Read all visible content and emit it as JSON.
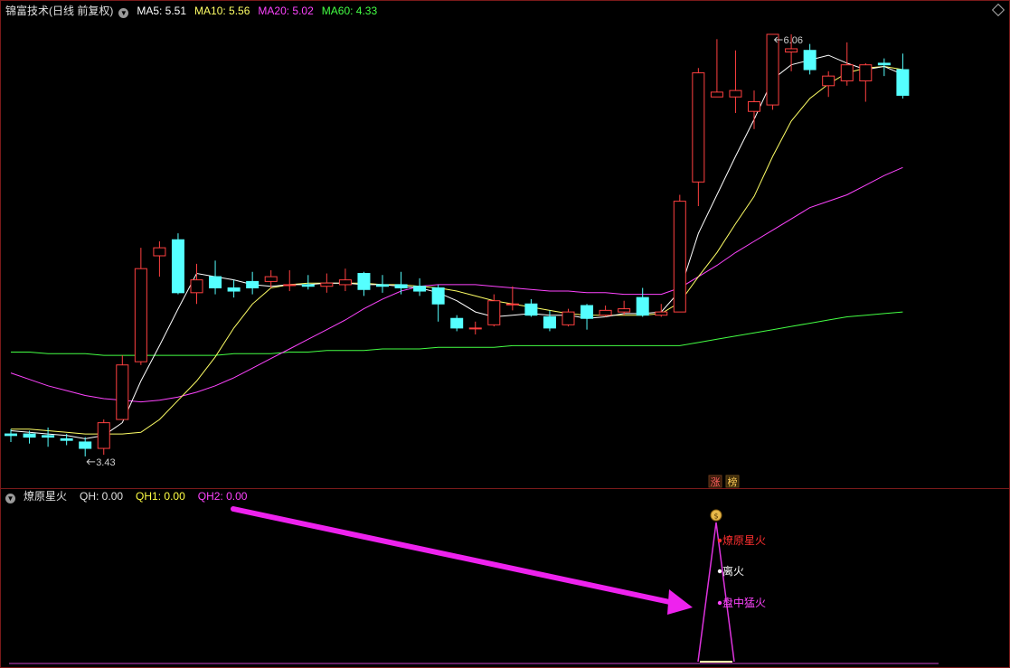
{
  "main_panel": {
    "title": "锦富技术(日线 前复权)",
    "indicators": [
      {
        "label": "MA5: 5.51",
        "color": "#ffffff"
      },
      {
        "label": "MA10: 5.56",
        "color": "#ffff66"
      },
      {
        "label": "MA20: 5.02",
        "color": "#ff44ff"
      },
      {
        "label": "MA60: 4.33",
        "color": "#44ff44"
      }
    ],
    "high_label": "6.06",
    "low_label": "3.43",
    "badges": [
      "涨",
      "榜"
    ]
  },
  "sub_panel": {
    "title": "燎原星火",
    "indicators": [
      {
        "label": "QH: 0.00",
        "color": "#e0e0e0"
      },
      {
        "label": "QH1: 0.00",
        "color": "#ffff44"
      },
      {
        "label": "QH2: 0.00",
        "color": "#ff44ff"
      }
    ],
    "signal_labels": [
      {
        "text": "燎原星火",
        "color": "#ff3030"
      },
      {
        "text": "离火",
        "color": "#ffffff"
      },
      {
        "text": "盘中猛火",
        "color": "#ff44ff"
      }
    ],
    "signal_icon": "money-bag-icon"
  },
  "colors": {
    "up": "#ff4040",
    "down": "#55ffff",
    "ma5": "#ffffff",
    "ma10": "#ffff66",
    "ma20": "#ff44ff",
    "ma60": "#44ff44"
  },
  "chart_data": {
    "type": "candlestick",
    "price_ylim": [
      3.3,
      6.15
    ],
    "candles": [
      [
        3.57,
        3.56,
        3.6,
        3.52
      ],
      [
        3.57,
        3.55,
        3.59,
        3.51
      ],
      [
        3.56,
        3.55,
        3.61,
        3.49
      ],
      [
        3.54,
        3.53,
        3.57,
        3.5
      ],
      [
        3.52,
        3.48,
        3.55,
        3.43
      ],
      [
        3.48,
        3.64,
        3.66,
        3.44
      ],
      [
        3.66,
        4.0,
        4.06,
        3.66
      ],
      [
        4.02,
        4.6,
        4.73,
        4.0
      ],
      [
        4.68,
        4.73,
        4.77,
        4.55
      ],
      [
        4.78,
        4.45,
        4.82,
        4.44
      ],
      [
        4.45,
        4.53,
        4.63,
        4.38
      ],
      [
        4.55,
        4.48,
        4.65,
        4.44
      ],
      [
        4.48,
        4.46,
        4.53,
        4.42
      ],
      [
        4.52,
        4.48,
        4.58,
        4.44
      ],
      [
        4.52,
        4.55,
        4.59,
        4.48
      ],
      [
        4.5,
        4.5,
        4.59,
        4.46
      ],
      [
        4.5,
        4.49,
        4.56,
        4.47
      ],
      [
        4.49,
        4.51,
        4.57,
        4.45
      ],
      [
        4.5,
        4.53,
        4.6,
        4.46
      ],
      [
        4.57,
        4.47,
        4.58,
        4.43
      ],
      [
        4.5,
        4.49,
        4.56,
        4.45
      ],
      [
        4.5,
        4.48,
        4.58,
        4.44
      ],
      [
        4.49,
        4.46,
        4.54,
        4.43
      ],
      [
        4.48,
        4.38,
        4.5,
        4.27
      ],
      [
        4.29,
        4.23,
        4.31,
        4.21
      ],
      [
        4.23,
        4.23,
        4.27,
        4.19
      ],
      [
        4.25,
        4.4,
        4.44,
        4.24
      ],
      [
        4.38,
        4.38,
        4.49,
        4.34
      ],
      [
        4.38,
        4.31,
        4.41,
        4.3
      ],
      [
        4.3,
        4.23,
        4.34,
        4.21
      ],
      [
        4.25,
        4.33,
        4.35,
        4.24
      ],
      [
        4.37,
        4.29,
        4.38,
        4.22
      ],
      [
        4.31,
        4.34,
        4.37,
        4.3
      ],
      [
        4.33,
        4.35,
        4.4,
        4.31
      ],
      [
        4.42,
        4.31,
        4.48,
        4.3
      ],
      [
        4.31,
        4.33,
        4.38,
        4.3
      ],
      [
        4.33,
        5.02,
        5.06,
        4.33
      ],
      [
        5.14,
        5.82,
        5.85,
        4.99
      ],
      [
        5.67,
        5.7,
        6.03,
        5.67
      ],
      [
        5.67,
        5.71,
        5.96,
        5.57
      ],
      [
        5.58,
        5.64,
        5.71,
        5.47
      ],
      [
        5.62,
        6.06,
        6.06,
        5.59
      ],
      [
        5.95,
        5.97,
        6.06,
        5.83
      ],
      [
        5.96,
        5.84,
        6.0,
        5.81
      ],
      [
        5.74,
        5.8,
        5.83,
        5.67
      ],
      [
        5.77,
        5.87,
        6.01,
        5.74
      ],
      [
        5.77,
        5.87,
        5.88,
        5.64
      ],
      [
        5.88,
        5.87,
        5.91,
        5.8
      ],
      [
        5.84,
        5.68,
        5.94,
        5.66
      ]
    ],
    "ma5": [
      3.59,
      3.58,
      3.57,
      3.56,
      3.54,
      3.56,
      3.64,
      3.9,
      4.12,
      4.35,
      4.57,
      4.55,
      4.53,
      4.5,
      4.49,
      4.5,
      4.5,
      4.51,
      4.51,
      4.5,
      4.5,
      4.49,
      4.48,
      4.45,
      4.4,
      4.33,
      4.3,
      4.31,
      4.32,
      4.31,
      4.31,
      4.29,
      4.3,
      4.32,
      4.32,
      4.33,
      4.46,
      4.82,
      5.06,
      5.3,
      5.53,
      5.78,
      5.87,
      5.9,
      5.93,
      5.88,
      5.84,
      5.86,
      5.81
    ],
    "ma10": [
      3.6,
      3.6,
      3.59,
      3.58,
      3.57,
      3.57,
      3.57,
      3.58,
      3.66,
      3.78,
      3.9,
      4.05,
      4.23,
      4.38,
      4.48,
      4.5,
      4.51,
      4.51,
      4.51,
      4.51,
      4.5,
      4.5,
      4.49,
      4.48,
      4.46,
      4.43,
      4.4,
      4.38,
      4.36,
      4.34,
      4.32,
      4.31,
      4.31,
      4.31,
      4.31,
      4.32,
      4.39,
      4.55,
      4.7,
      4.88,
      5.05,
      5.3,
      5.52,
      5.66,
      5.75,
      5.82,
      5.85,
      5.86,
      5.84
    ],
    "ma20": [
      3.95,
      3.91,
      3.87,
      3.84,
      3.81,
      3.79,
      3.78,
      3.77,
      3.78,
      3.8,
      3.83,
      3.87,
      3.92,
      3.98,
      4.04,
      4.1,
      4.16,
      4.22,
      4.28,
      4.35,
      4.41,
      4.46,
      4.49,
      4.5,
      4.5,
      4.5,
      4.49,
      4.48,
      4.47,
      4.46,
      4.46,
      4.45,
      4.45,
      4.44,
      4.44,
      4.44,
      4.48,
      4.55,
      4.62,
      4.7,
      4.77,
      4.84,
      4.91,
      4.98,
      5.02,
      5.06,
      5.12,
      5.18,
      5.23
    ],
    "ma60": [
      4.08,
      4.08,
      4.07,
      4.07,
      4.07,
      4.06,
      4.06,
      4.06,
      4.06,
      4.06,
      4.06,
      4.06,
      4.07,
      4.07,
      4.07,
      4.08,
      4.08,
      4.09,
      4.09,
      4.09,
      4.1,
      4.1,
      4.1,
      4.11,
      4.11,
      4.11,
      4.11,
      4.12,
      4.12,
      4.12,
      4.12,
      4.12,
      4.12,
      4.12,
      4.12,
      4.12,
      4.12,
      4.14,
      4.16,
      4.18,
      4.2,
      4.22,
      4.24,
      4.26,
      4.28,
      4.3,
      4.31,
      4.32,
      4.33
    ]
  }
}
